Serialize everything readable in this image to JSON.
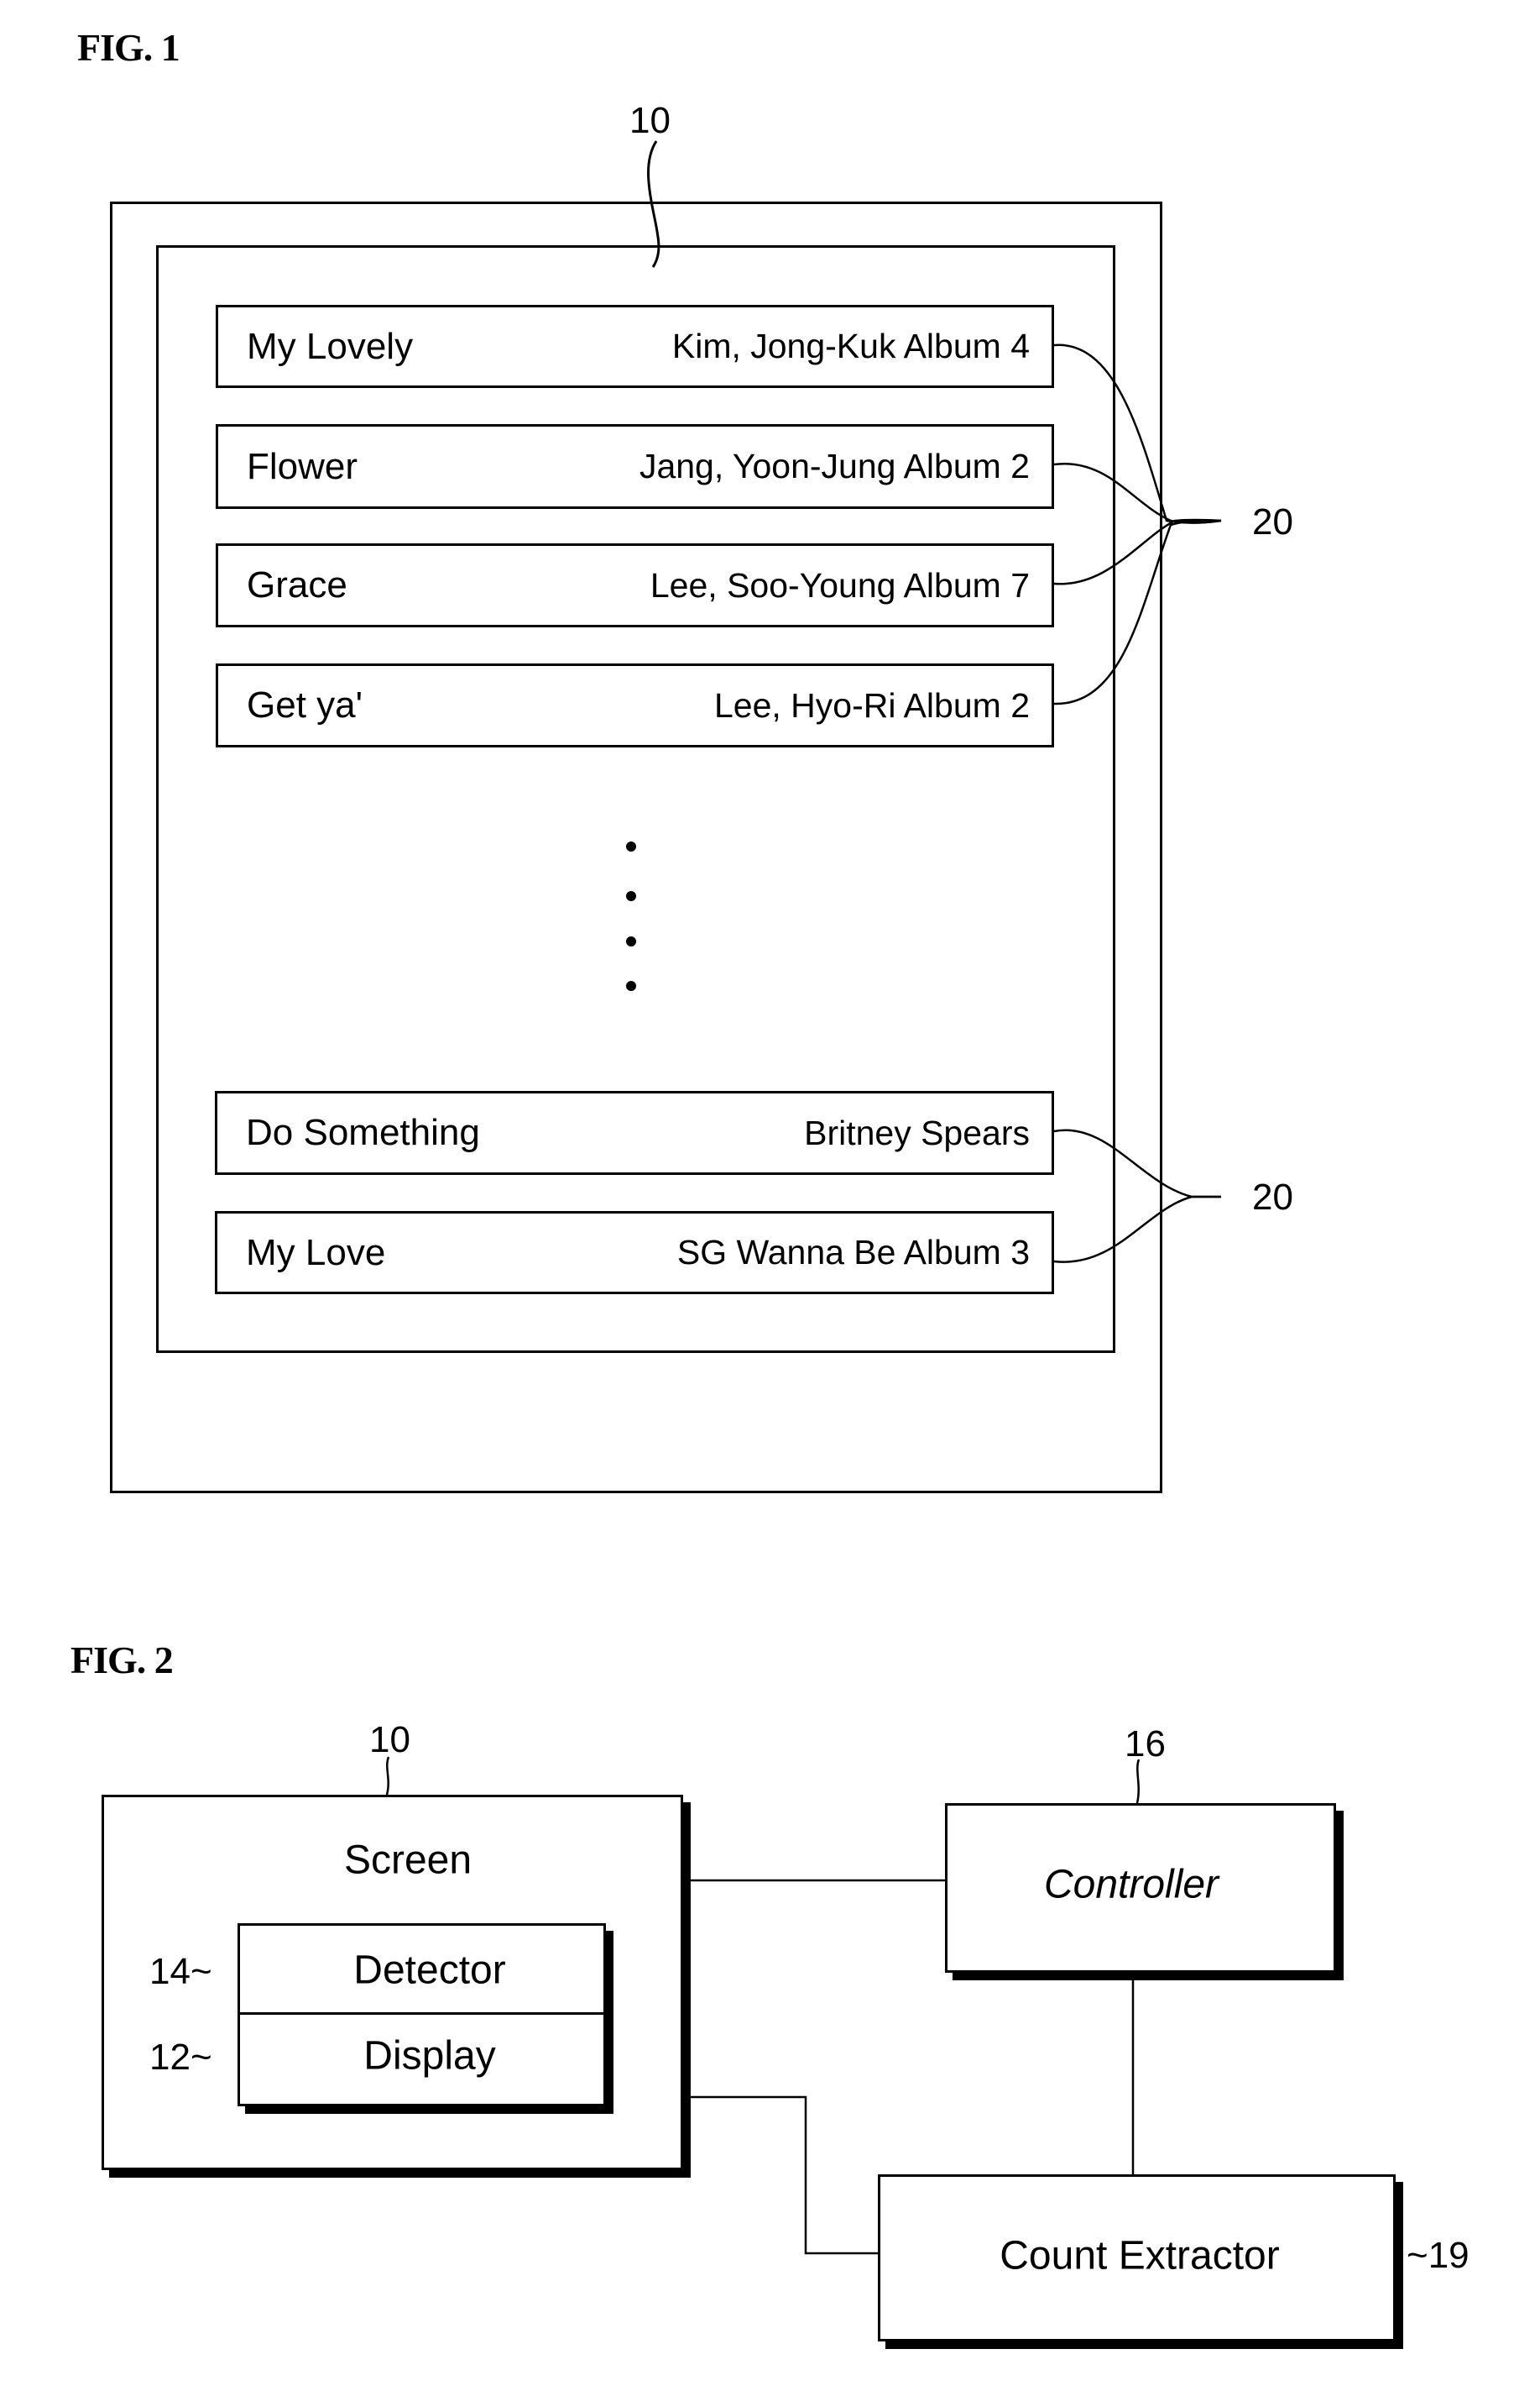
{
  "fig1": {
    "title": "FIG. 1",
    "screen_ref": "10",
    "item_ref_top": "20",
    "item_ref_bottom": "20",
    "items": [
      {
        "title": "My Lovely",
        "artist": "Kim, Jong-Kuk Album 4"
      },
      {
        "title": "Flower",
        "artist": "Jang, Yoon-Jung Album 2"
      },
      {
        "title": "Grace",
        "artist": "Lee, Soo-Young Album 7"
      },
      {
        "title": "Get ya'",
        "artist": "Lee, Hyo-Ri Album 2"
      },
      {
        "title": "Do Something",
        "artist": "Britney Spears"
      },
      {
        "title": "My Love",
        "artist": "SG Wanna Be Album 3"
      }
    ],
    "ellipsis_icon": "vertical-ellipsis"
  },
  "fig2": {
    "title": "FIG. 2",
    "screen": {
      "ref": "10",
      "label": "Screen"
    },
    "detector": {
      "ref": "14~",
      "label": "Detector"
    },
    "display": {
      "ref": "12~",
      "label": "Display"
    },
    "controller": {
      "ref": "16",
      "label": "Controller"
    },
    "count_extractor": {
      "ref": "~19",
      "label": "Count Extractor"
    }
  }
}
